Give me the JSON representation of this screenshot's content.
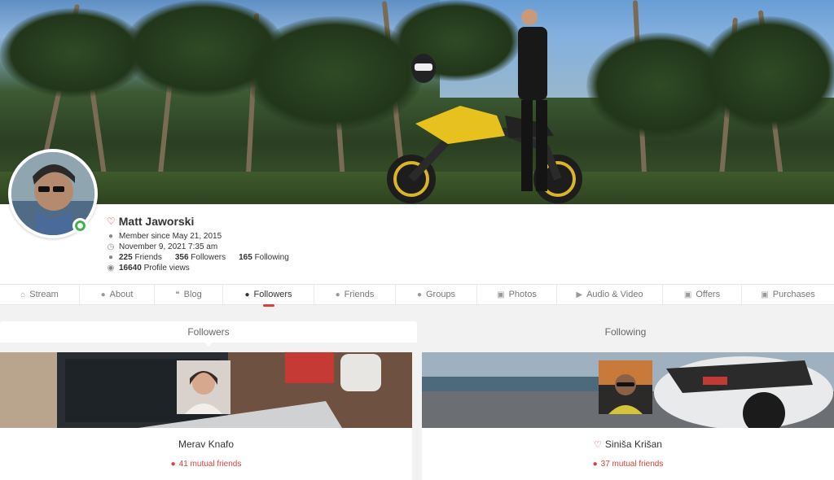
{
  "profile": {
    "name": "Matt Jaworski",
    "member_since": "Member since May 21, 2015",
    "last_seen": "November 9, 2021 7:35 am",
    "friends_count": "225",
    "friends_label": "Friends",
    "followers_count": "356",
    "followers_label": "Followers",
    "following_count": "165",
    "following_label": "Following",
    "views_count": "16640",
    "views_label": "Profile views",
    "status": "online"
  },
  "nav": {
    "items": [
      {
        "label": "Stream",
        "icon": "home-icon"
      },
      {
        "label": "About",
        "icon": "user-circle-icon"
      },
      {
        "label": "Blog",
        "icon": "quote-icon"
      },
      {
        "label": "Followers",
        "icon": "user-check-icon",
        "active": true
      },
      {
        "label": "Friends",
        "icon": "users-icon"
      },
      {
        "label": "Groups",
        "icon": "group-icon"
      },
      {
        "label": "Photos",
        "icon": "camera-icon"
      },
      {
        "label": "Audio & Video",
        "icon": "youtube-icon"
      },
      {
        "label": "Offers",
        "icon": "gift-icon"
      },
      {
        "label": "Purchases",
        "icon": "cart-icon"
      }
    ]
  },
  "subtabs": {
    "followers": "Followers",
    "following": "Following"
  },
  "cards": [
    {
      "name": "Merav Knafo",
      "mutual": "41 mutual friends",
      "flag": false
    },
    {
      "name": "Siniša Krišan",
      "mutual": "37 mutual friends",
      "flag": true
    }
  ],
  "colors": {
    "accent": "#d8413a",
    "online": "#3cb34a"
  }
}
